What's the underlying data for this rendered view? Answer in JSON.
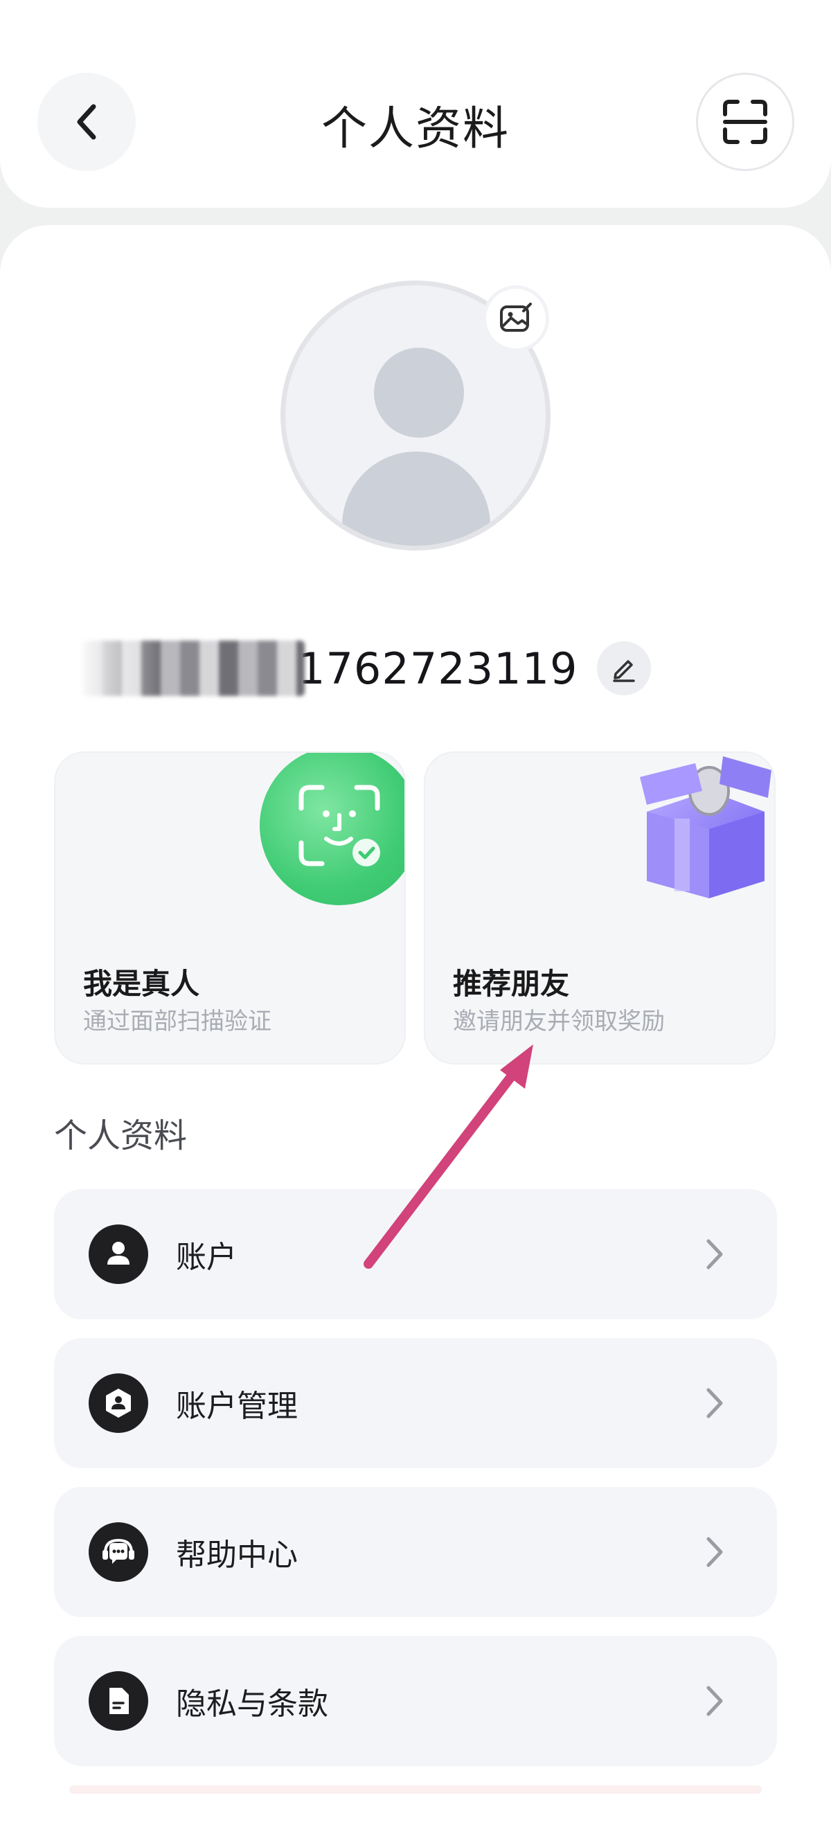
{
  "header": {
    "title": "个人资料",
    "back_icon": "chevron-left-icon",
    "scan_icon": "scan-icon"
  },
  "profile": {
    "display_name_suffix": "1762723119",
    "avatar_edit_icon": "image-edit-icon",
    "name_edit_icon": "pencil-icon"
  },
  "features": [
    {
      "title": "我是真人",
      "subtitle": "通过面部扫描验证",
      "icon": "face-scan-icon",
      "accent": "#3fcb73"
    },
    {
      "title": "推荐朋友",
      "subtitle": "邀请朋友并领取奖励",
      "icon": "gift-box-icon",
      "accent": "#8b7cf6"
    }
  ],
  "section": {
    "title": "个人资料"
  },
  "menu": [
    {
      "label": "账户",
      "icon": "user-icon"
    },
    {
      "label": "账户管理",
      "icon": "shield-user-icon"
    },
    {
      "label": "帮助中心",
      "icon": "support-chat-icon"
    },
    {
      "label": "隐私与条款",
      "icon": "document-icon"
    }
  ],
  "colors": {
    "annotation_arrow": "#d1437a",
    "icon_dark": "#1f1f22"
  }
}
